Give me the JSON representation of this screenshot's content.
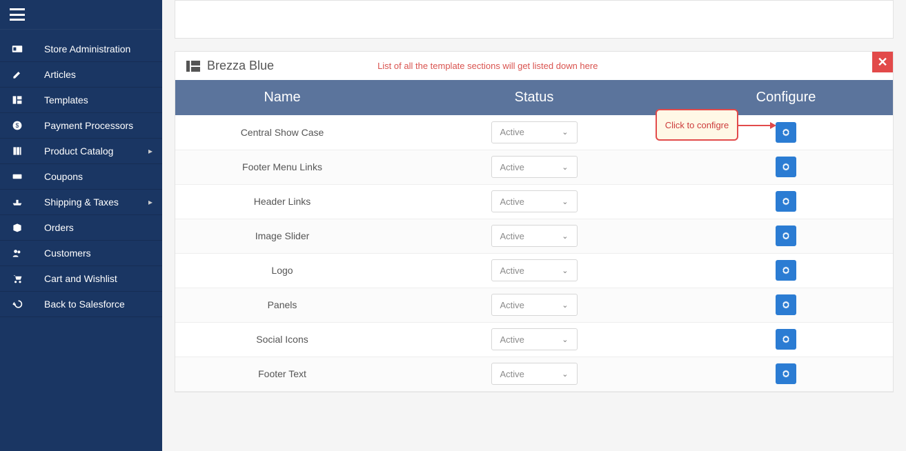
{
  "sidebar": {
    "items": [
      {
        "label": "Store Administration",
        "icon": "id-card",
        "chevron": false
      },
      {
        "label": "Articles",
        "icon": "edit",
        "chevron": false
      },
      {
        "label": "Templates",
        "icon": "layout",
        "chevron": false
      },
      {
        "label": "Payment Processors",
        "icon": "money",
        "chevron": false
      },
      {
        "label": "Product Catalog",
        "icon": "book",
        "chevron": true
      },
      {
        "label": "Coupons",
        "icon": "ticket",
        "chevron": false
      },
      {
        "label": "Shipping & Taxes",
        "icon": "ship",
        "chevron": true
      },
      {
        "label": "Orders",
        "icon": "box",
        "chevron": false
      },
      {
        "label": "Customers",
        "icon": "users",
        "chevron": false
      },
      {
        "label": "Cart and Wishlist",
        "icon": "cart",
        "chevron": false
      },
      {
        "label": "Back to Salesforce",
        "icon": "back",
        "chevron": false
      }
    ]
  },
  "panel": {
    "title": "Brezza Blue",
    "subtitle": "List of all the template sections will get listed down here"
  },
  "table": {
    "headers": {
      "name": "Name",
      "status": "Status",
      "configure": "Configure"
    },
    "rows": [
      {
        "name": "Central Show Case",
        "status": "Active"
      },
      {
        "name": "Footer Menu Links",
        "status": "Active"
      },
      {
        "name": "Header Links",
        "status": "Active"
      },
      {
        "name": "Image Slider",
        "status": "Active"
      },
      {
        "name": "Logo",
        "status": "Active"
      },
      {
        "name": "Panels",
        "status": "Active"
      },
      {
        "name": "Social Icons",
        "status": "Active"
      },
      {
        "name": "Footer Text",
        "status": "Active"
      }
    ]
  },
  "callout": {
    "text": "Click to configre"
  }
}
